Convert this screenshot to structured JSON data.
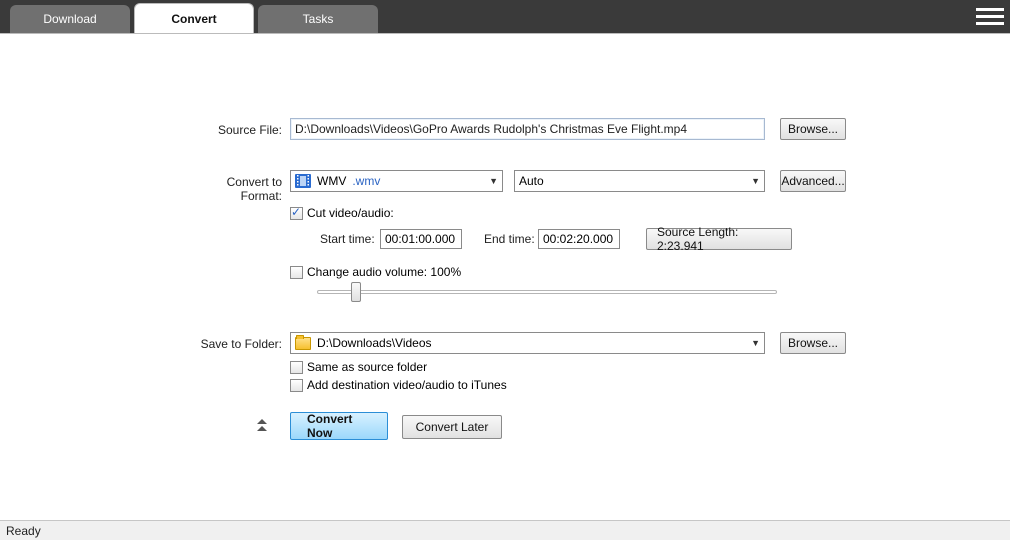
{
  "tabs": {
    "download": "Download",
    "convert": "Convert",
    "tasks": "Tasks"
  },
  "labels": {
    "source_file": "Source File:",
    "convert_to_format": "Convert to Format:",
    "cut": "Cut video/audio:",
    "start_time": "Start time:",
    "end_time": "End time:",
    "change_volume": "Change audio volume: 100%",
    "save_to_folder": "Save to Folder:",
    "same_as_source": "Same as source folder",
    "add_itunes": "Add destination video/audio to iTunes"
  },
  "values": {
    "source_file": "D:\\Downloads\\Videos\\GoPro Awards  Rudolph's Christmas Eve Flight.mp4",
    "format_name": "WMV",
    "format_ext": ".wmv",
    "format_profile": "Auto",
    "start_time": "00:01:00.000",
    "end_time": "00:02:20.000",
    "source_length": "Source Length: 2:23.941",
    "save_folder": "D:\\Downloads\\Videos"
  },
  "buttons": {
    "browse": "Browse...",
    "advanced": "Advanced...",
    "convert_now": "Convert Now",
    "convert_later": "Convert Later"
  },
  "status": "Ready"
}
